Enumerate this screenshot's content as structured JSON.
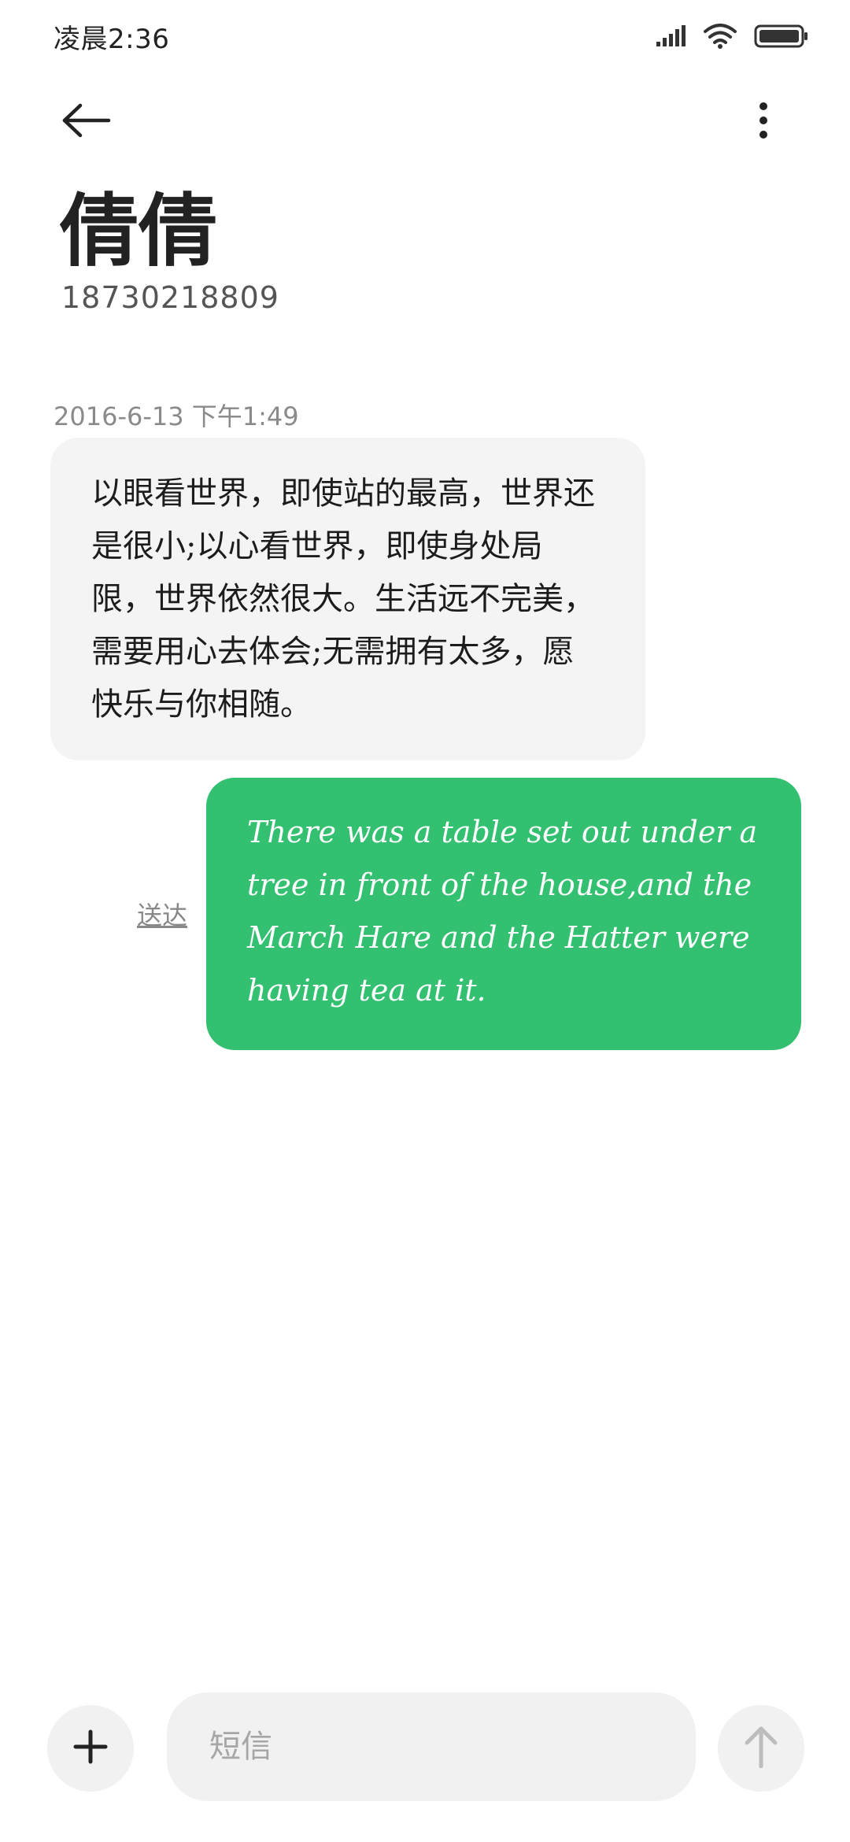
{
  "status_bar": {
    "time": "凌晨2:36",
    "icons": [
      "signal-icon",
      "wifi-icon",
      "battery-icon"
    ]
  },
  "header": {
    "contact_name": "倩倩",
    "contact_number": "18730218809",
    "icons": [
      "back-arrow-icon",
      "more-vertical-icon"
    ]
  },
  "conversation": {
    "timestamp": "2016-6-13 下午1:49",
    "incoming_message": "以眼看世界，即使站的最高，世界还是很小;以心看世界，即使身处局限，世界依然很大。生活远不完美，需要用心去体会;无需拥有太多，愿快乐与你相随。",
    "outgoing_message": "There was a table set out under a tree in front of the house,and the March Hare and the Hatter were having tea at it.",
    "delivery_status": "送达"
  },
  "composer": {
    "placeholder": "短信",
    "value": "",
    "icons": [
      "plus-icon",
      "send-arrow-up-icon"
    ]
  },
  "colors": {
    "outgoing_bubble": "#33c070",
    "incoming_bubble": "#f4f4f4",
    "input_background": "#f1f1f1"
  }
}
